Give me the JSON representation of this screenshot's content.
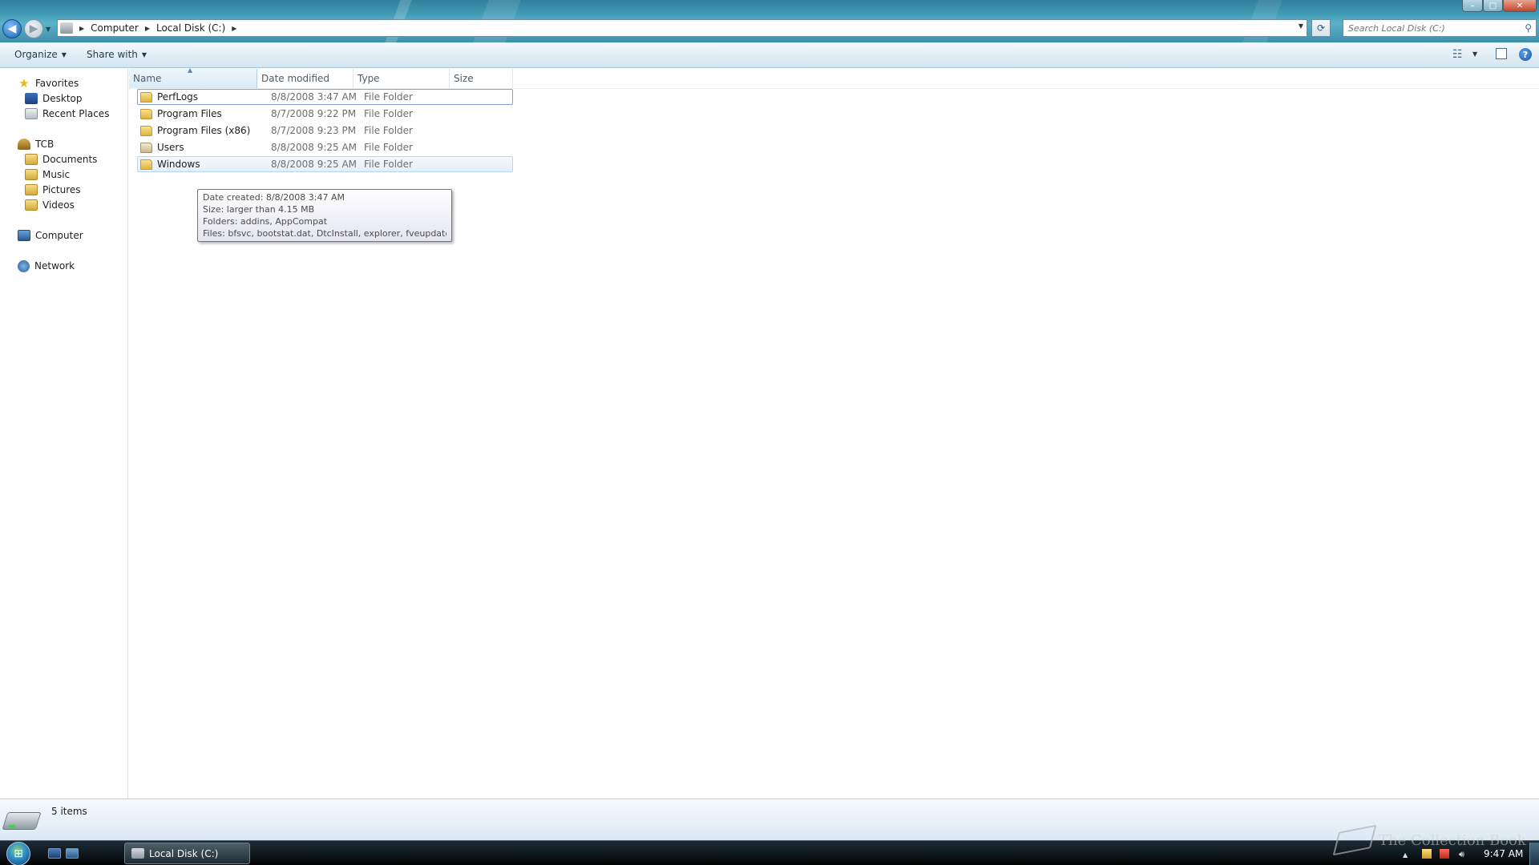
{
  "window": {
    "controls": {
      "minimize": "–",
      "maximize": "□",
      "close": "✕"
    }
  },
  "address": {
    "breadcrumbs": [
      "Computer",
      "Local Disk (C:)"
    ],
    "search_placeholder": "Search Local Disk (C:)"
  },
  "toolbar": {
    "organize_label": "Organize",
    "share_label": "Share with"
  },
  "nav": {
    "favorites": {
      "label": "Favorites",
      "items": [
        "Desktop",
        "Recent Places"
      ]
    },
    "user": {
      "label": "TCB",
      "items": [
        "Documents",
        "Music",
        "Pictures",
        "Videos"
      ]
    },
    "computer": "Computer",
    "network": "Network"
  },
  "columns": {
    "name": "Name",
    "date": "Date modified",
    "type": "Type",
    "size": "Size"
  },
  "files": [
    {
      "name": "PerfLogs",
      "date": "8/8/2008 3:47 AM",
      "type": "File Folder",
      "size": ""
    },
    {
      "name": "Program Files",
      "date": "8/7/2008 9:22 PM",
      "type": "File Folder",
      "size": ""
    },
    {
      "name": "Program Files (x86)",
      "date": "8/7/2008 9:23 PM",
      "type": "File Folder",
      "size": ""
    },
    {
      "name": "Users",
      "date": "8/8/2008 9:25 AM",
      "type": "File Folder",
      "size": ""
    },
    {
      "name": "Windows",
      "date": "8/8/2008 9:25 AM",
      "type": "File Folder",
      "size": ""
    }
  ],
  "tooltip": {
    "line1": "Date created: 8/8/2008 3:47 AM",
    "line2": "Size: larger than 4.15 MB",
    "line3": "Folders: addins, AppCompat",
    "line4": "Files: bfsvc, bootstat.dat, DtcInstall, explorer, fveupdate, ..."
  },
  "details": {
    "item_count": "5 items"
  },
  "taskbar": {
    "active_window": "Local Disk (C:)",
    "clock": "9:47 AM",
    "watermark": "The Collection Book"
  },
  "colors": {
    "accent": "#3f98b4",
    "selection_border": "#7da2ce",
    "hover_fill": "#e3f0fb"
  }
}
